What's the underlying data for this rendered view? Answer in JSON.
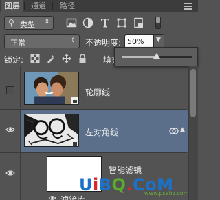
{
  "tabs": [
    {
      "label": "图层",
      "active": true
    },
    {
      "label": "通道",
      "active": false
    },
    {
      "label": "路径",
      "active": false
    }
  ],
  "filter": {
    "kind_label": "类型",
    "search_glyph": "⚲"
  },
  "filter_icons": [
    "image-filter-icon",
    "adjustment-filter-icon",
    "type-filter-icon",
    "shape-filter-icon",
    "smart-object-filter-icon"
  ],
  "blend": {
    "mode": "正常",
    "opacity_label": "不透明度:",
    "opacity_value": "50%",
    "opacity_level": 0.5
  },
  "lock": {
    "label": "锁定:",
    "fill_label_partial": "填充"
  },
  "layers": [
    {
      "name": "轮廓线",
      "visible": false,
      "selected": false
    },
    {
      "name": "左对角线",
      "visible": true,
      "selected": true
    },
    {
      "name": "智能滤镜",
      "visible": true,
      "selected": false
    },
    {
      "name": "滤镜库",
      "visible": true,
      "selected": false
    }
  ],
  "watermark": {
    "u": "U",
    "i": "i",
    "b": "B",
    "q": "Q",
    "dot": ".",
    "com": "CoM",
    "sub": "www.psahz.com"
  },
  "colors": {
    "selected_row": "#5b6f8a",
    "panel_bg": "#535353",
    "watermark_blue": "#1a72c9",
    "watermark_red": "#d8262a",
    "watermark_green": "#5bab2f"
  }
}
